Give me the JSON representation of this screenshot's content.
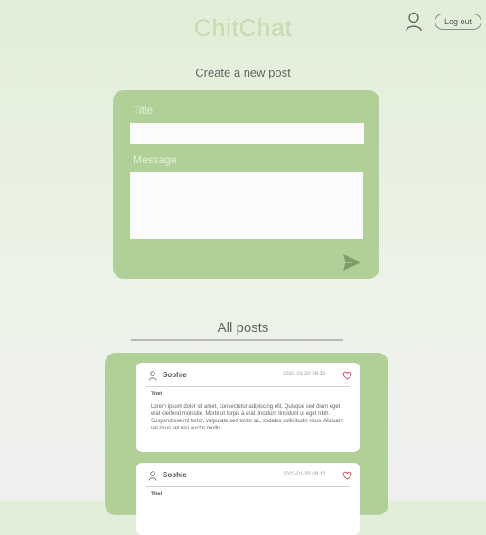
{
  "header": {
    "app_title": "ChitChat",
    "logout_label": "Log out"
  },
  "create_post": {
    "heading": "Create a new post",
    "title_label": "Title",
    "message_label": "Message"
  },
  "posts_section": {
    "heading": "All posts",
    "posts": [
      {
        "author": "Sophie",
        "timestamp": "2023-01-20  09:12",
        "title": "Titel",
        "body": "Lorem ipsum dolor sit amet, consectetur adipiscing elit. Quisque sed diam eget erat eleifend molestie. Morbi ut turpis a erat tincidunt tincidunt ut eget nibh. Suspendisse mi tortor, vulputate sed tortor ac, sodales sollicitudin risus. Aliquam vel risus vel nisi auctor mollis."
      },
      {
        "author": "Sophie",
        "timestamp": "2023-01-20  09:12",
        "title": "Titel",
        "body": ""
      }
    ]
  },
  "icons": {
    "user": "user-icon",
    "send": "send-icon",
    "heart": "heart-icon"
  },
  "colors": {
    "accent_green": "#b1d097",
    "title_green": "#c4dcb0",
    "heart_red": "#d9506a"
  }
}
